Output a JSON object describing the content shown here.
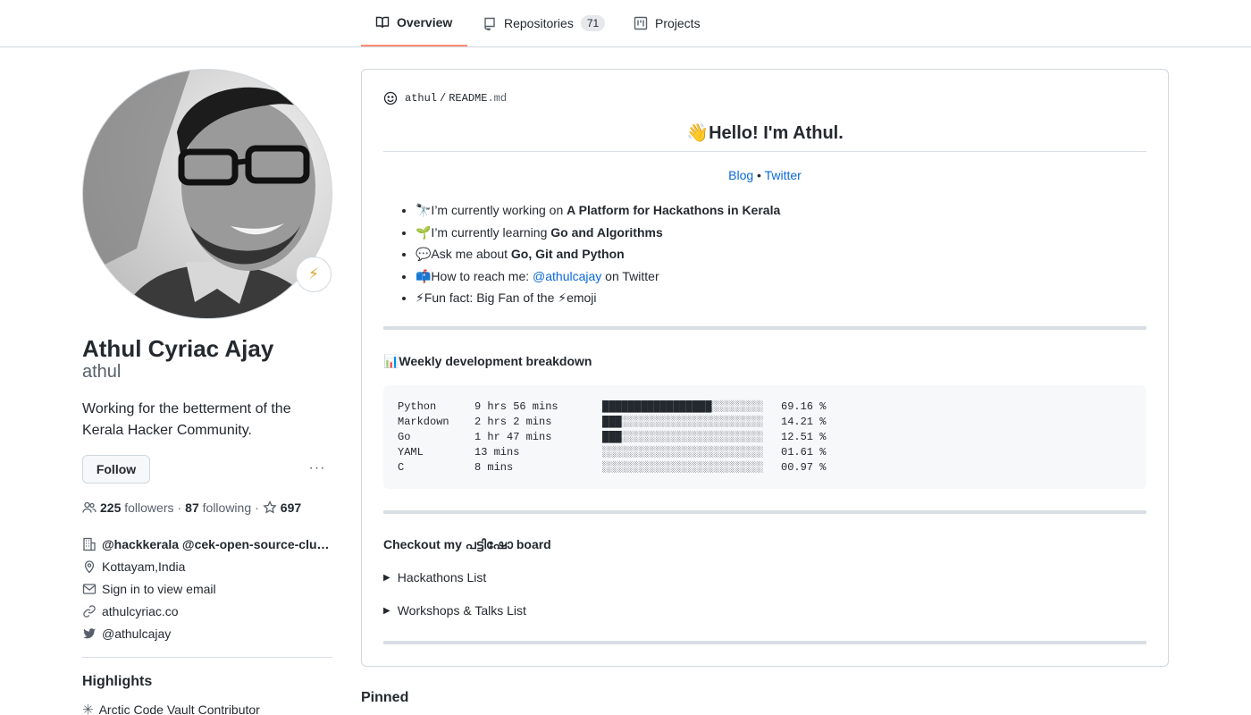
{
  "tabs": [
    {
      "label": "Overview",
      "icon": "book-icon",
      "active": true
    },
    {
      "label": "Repositories",
      "icon": "repo-icon",
      "count": "71"
    },
    {
      "label": "Projects",
      "icon": "project-icon"
    }
  ],
  "profile": {
    "status_emoji": "⚡",
    "fullname": "Athul Cyriac Ajay",
    "username": "athul",
    "bio": "Working for the betterment of the Kerala Hacker Community.",
    "follow_label": "Follow",
    "more_label": "···",
    "followers_count": "225",
    "followers_label": "followers",
    "following_count": "87",
    "following_label": "following",
    "stars_count": "697",
    "organization": "@hackkerala @cek-open-source-clu…",
    "location": "Kottayam,India",
    "email": "Sign in to view email",
    "website": "athulcyriac.co",
    "twitter": "@athulcajay"
  },
  "highlights": {
    "title": "Highlights",
    "item": "Arctic Code Vault Contributor"
  },
  "readme": {
    "owner": "athul",
    "separator": "/",
    "file": "README",
    "ext": ".md",
    "heading": "👋Hello! I'm Athul.",
    "link_blog": "Blog",
    "link_sep": " • ",
    "link_twitter": "Twitter",
    "bullets": [
      {
        "pre": "🔭I’m currently working on ",
        "bold": "A Platform for Hackathons in Kerala"
      },
      {
        "pre": "🌱I’m currently learning ",
        "bold": "Go and Algorithms"
      },
      {
        "pre": "💬Ask me about ",
        "bold": "Go, Git and Python"
      },
      {
        "pre": "📫How to reach me: ",
        "link": "@athulcajay",
        "post": " on Twitter"
      },
      {
        "pre": "⚡Fun fact: Big Fan of the ⚡emoji"
      }
    ],
    "weekly_title": "📊Weekly development breakdown",
    "weekly": [
      {
        "lang": "Python",
        "time": "9 hrs 56 mins",
        "bar": "█████████████████░░░░░░░░",
        "pct": "69.16 %"
      },
      {
        "lang": "Markdown",
        "time": "2 hrs 2 mins",
        "bar": "███░░░░░░░░░░░░░░░░░░░░░░",
        "pct": "14.21 %"
      },
      {
        "lang": "Go",
        "time": "1 hr 47 mins",
        "bar": "███░░░░░░░░░░░░░░░░░░░░░░",
        "pct": "12.51 %"
      },
      {
        "lang": "YAML",
        "time": "13 mins",
        "bar": "░░░░░░░░░░░░░░░░░░░░░░░░░",
        "pct": "01.61 %"
      },
      {
        "lang": "C",
        "time": "8 mins",
        "bar": "░░░░░░░░░░░░░░░░░░░░░░░░░",
        "pct": "00.97 %"
      }
    ],
    "board_title": "Checkout my പട്ടിഷോ board",
    "details": [
      "Hackathons List",
      "Workshops & Talks List"
    ]
  },
  "pinned_label": "Pinned"
}
